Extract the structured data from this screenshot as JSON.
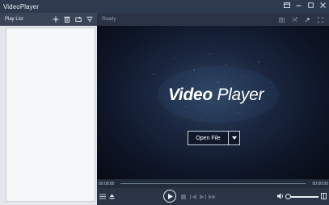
{
  "window": {
    "title": "VideoPlayer",
    "controls": [
      "pin-icon",
      "minimize-icon",
      "maximize-icon",
      "close-icon"
    ]
  },
  "playlist": {
    "title": "Play List",
    "tools": [
      "add-icon",
      "delete-icon",
      "repeat-icon",
      "filter-icon"
    ],
    "items": []
  },
  "player": {
    "status": "Ready",
    "header_tools": [
      "screenshot-icon",
      "shuffle-icon",
      "pin-icon",
      "fullscreen-icon"
    ],
    "logo": {
      "bold": "Video",
      "light": "Player"
    },
    "open_file_label": "Open File",
    "current_time": "00:00:00",
    "total_time": "00:00:00"
  },
  "colors": {
    "titlebar": "#2e3b4e",
    "playlist_header": "#3a4658",
    "player_bar": "#2b3444",
    "video_bg": "#0d1526"
  }
}
